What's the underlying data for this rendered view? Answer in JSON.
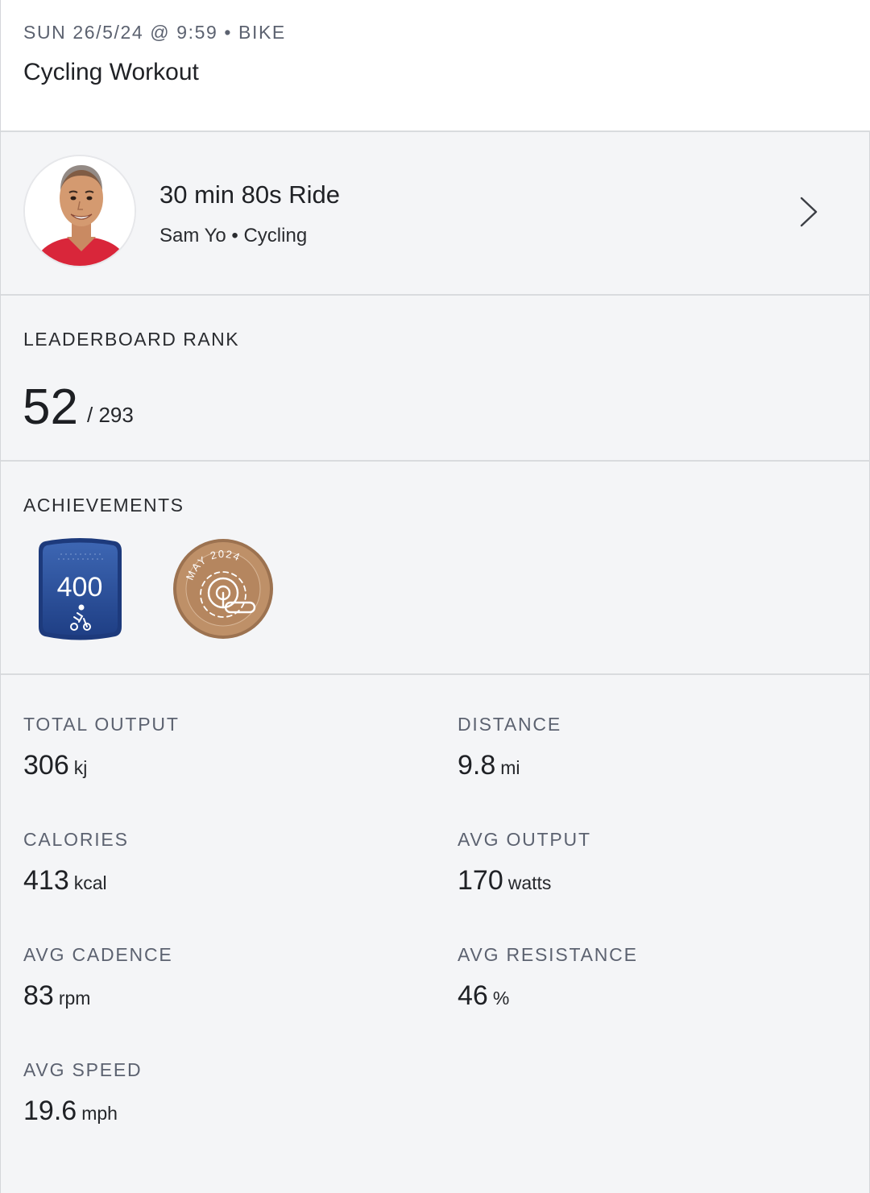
{
  "header": {
    "meta": "SUN 26/5/24 @ 9:59 • BIKE",
    "title": "Cycling Workout"
  },
  "class_info": {
    "title": "30 min 80s Ride",
    "subtitle": "Sam Yo • Cycling",
    "avatar_icon": "instructor-avatar",
    "chevron_icon": "chevron-right-icon"
  },
  "leaderboard": {
    "label": "LEADERBOARD RANK",
    "rank": "52",
    "total": "/ 293"
  },
  "achievements": {
    "label": "ACHIEVEMENTS",
    "badges": [
      {
        "icon": "400-rides-badge",
        "text": "400",
        "color": "#2a4f96"
      },
      {
        "icon": "monthly-challenge-badge",
        "text": "MAY 2024",
        "color": "#b98a63"
      }
    ]
  },
  "stats": [
    {
      "label": "TOTAL OUTPUT",
      "value": "306",
      "unit": "kj"
    },
    {
      "label": "DISTANCE",
      "value": "9.8",
      "unit": "mi"
    },
    {
      "label": "CALORIES",
      "value": "413",
      "unit": "kcal"
    },
    {
      "label": "AVG OUTPUT",
      "value": "170",
      "unit": "watts"
    },
    {
      "label": "AVG CADENCE",
      "value": "83",
      "unit": "rpm"
    },
    {
      "label": "AVG RESISTANCE",
      "value": "46",
      "unit": "%"
    },
    {
      "label": "AVG SPEED",
      "value": "19.6",
      "unit": "mph"
    }
  ]
}
